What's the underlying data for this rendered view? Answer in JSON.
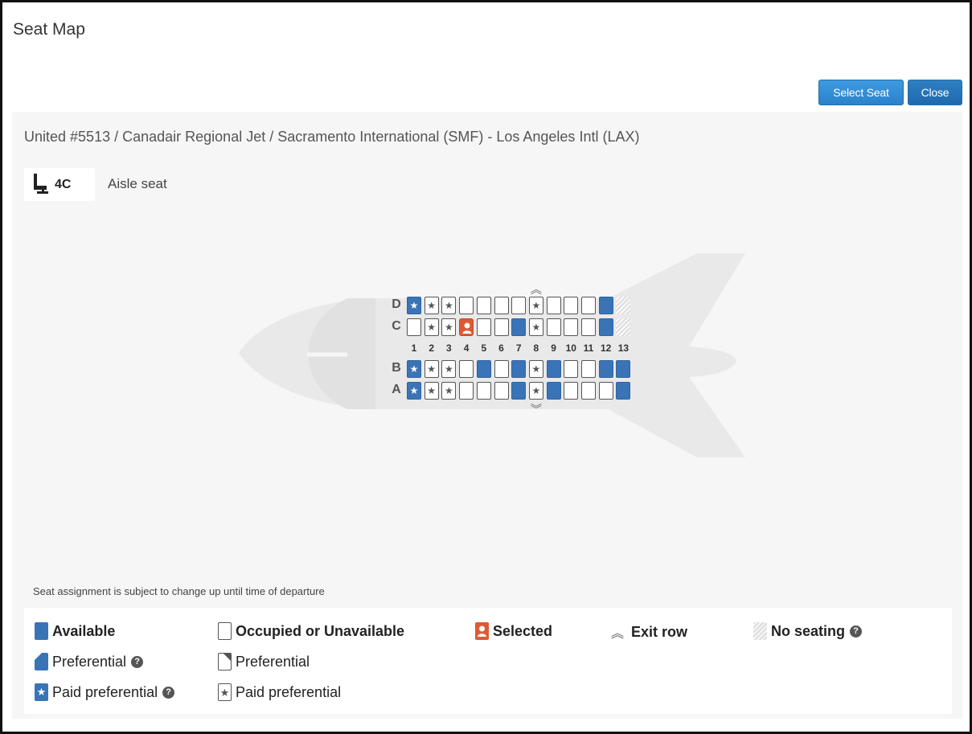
{
  "dialog": {
    "title": "Seat Map",
    "select_label": "Select Seat",
    "close_label": "Close"
  },
  "route": {
    "airline": "United #5513",
    "aircraft": "Canadair Regional Jet",
    "origin": "Sacramento International (SMF)",
    "destination": "Los Angeles Intl (LAX)",
    "sep1": " / ",
    "sep2": " / ",
    "sep3": " - "
  },
  "selected_seat": {
    "icon": "seat-icon",
    "code": "4C",
    "description": "Aisle seat"
  },
  "seat_map": {
    "row_letters": [
      "D",
      "C",
      "B",
      "A"
    ],
    "columns": [
      "1",
      "2",
      "3",
      "4",
      "5",
      "6",
      "7",
      "8",
      "9",
      "10",
      "11",
      "12",
      "13"
    ],
    "exit_row_column": "8",
    "seats": {
      "D": [
        "paid-av",
        "paid-occ",
        "paid-occ",
        "occ",
        "occ",
        "occ",
        "occ",
        "paid-occ",
        "occ",
        "occ",
        "occ",
        "av",
        "none"
      ],
      "C": [
        "occ",
        "paid-occ",
        "paid-occ",
        "selected",
        "occ",
        "occ",
        "av",
        "paid-occ",
        "occ",
        "occ",
        "occ",
        "av",
        "none"
      ],
      "B": [
        "paid-av",
        "paid-occ",
        "paid-occ",
        "occ",
        "av",
        "occ",
        "av",
        "paid-occ",
        "av",
        "occ",
        "occ",
        "av",
        "av"
      ],
      "A": [
        "paid-av",
        "paid-occ",
        "paid-occ",
        "occ",
        "occ",
        "occ",
        "av",
        "paid-occ",
        "av",
        "occ",
        "occ",
        "occ",
        "av"
      ]
    },
    "colors": {
      "available": "#3a74b7",
      "selected": "#dd5a33",
      "occupied_border": "#555555"
    }
  },
  "disclaimer": "Seat assignment is subject to change up until time of departure",
  "legend": {
    "available": "Available",
    "occupied": "Occupied or Unavailable",
    "selected": "Selected",
    "exit_row": "Exit row",
    "no_seating": "No seating",
    "preferential_av": "Preferential",
    "preferential_occ": "Preferential",
    "paid_av": "Paid preferential",
    "paid_occ": "Paid preferential"
  }
}
